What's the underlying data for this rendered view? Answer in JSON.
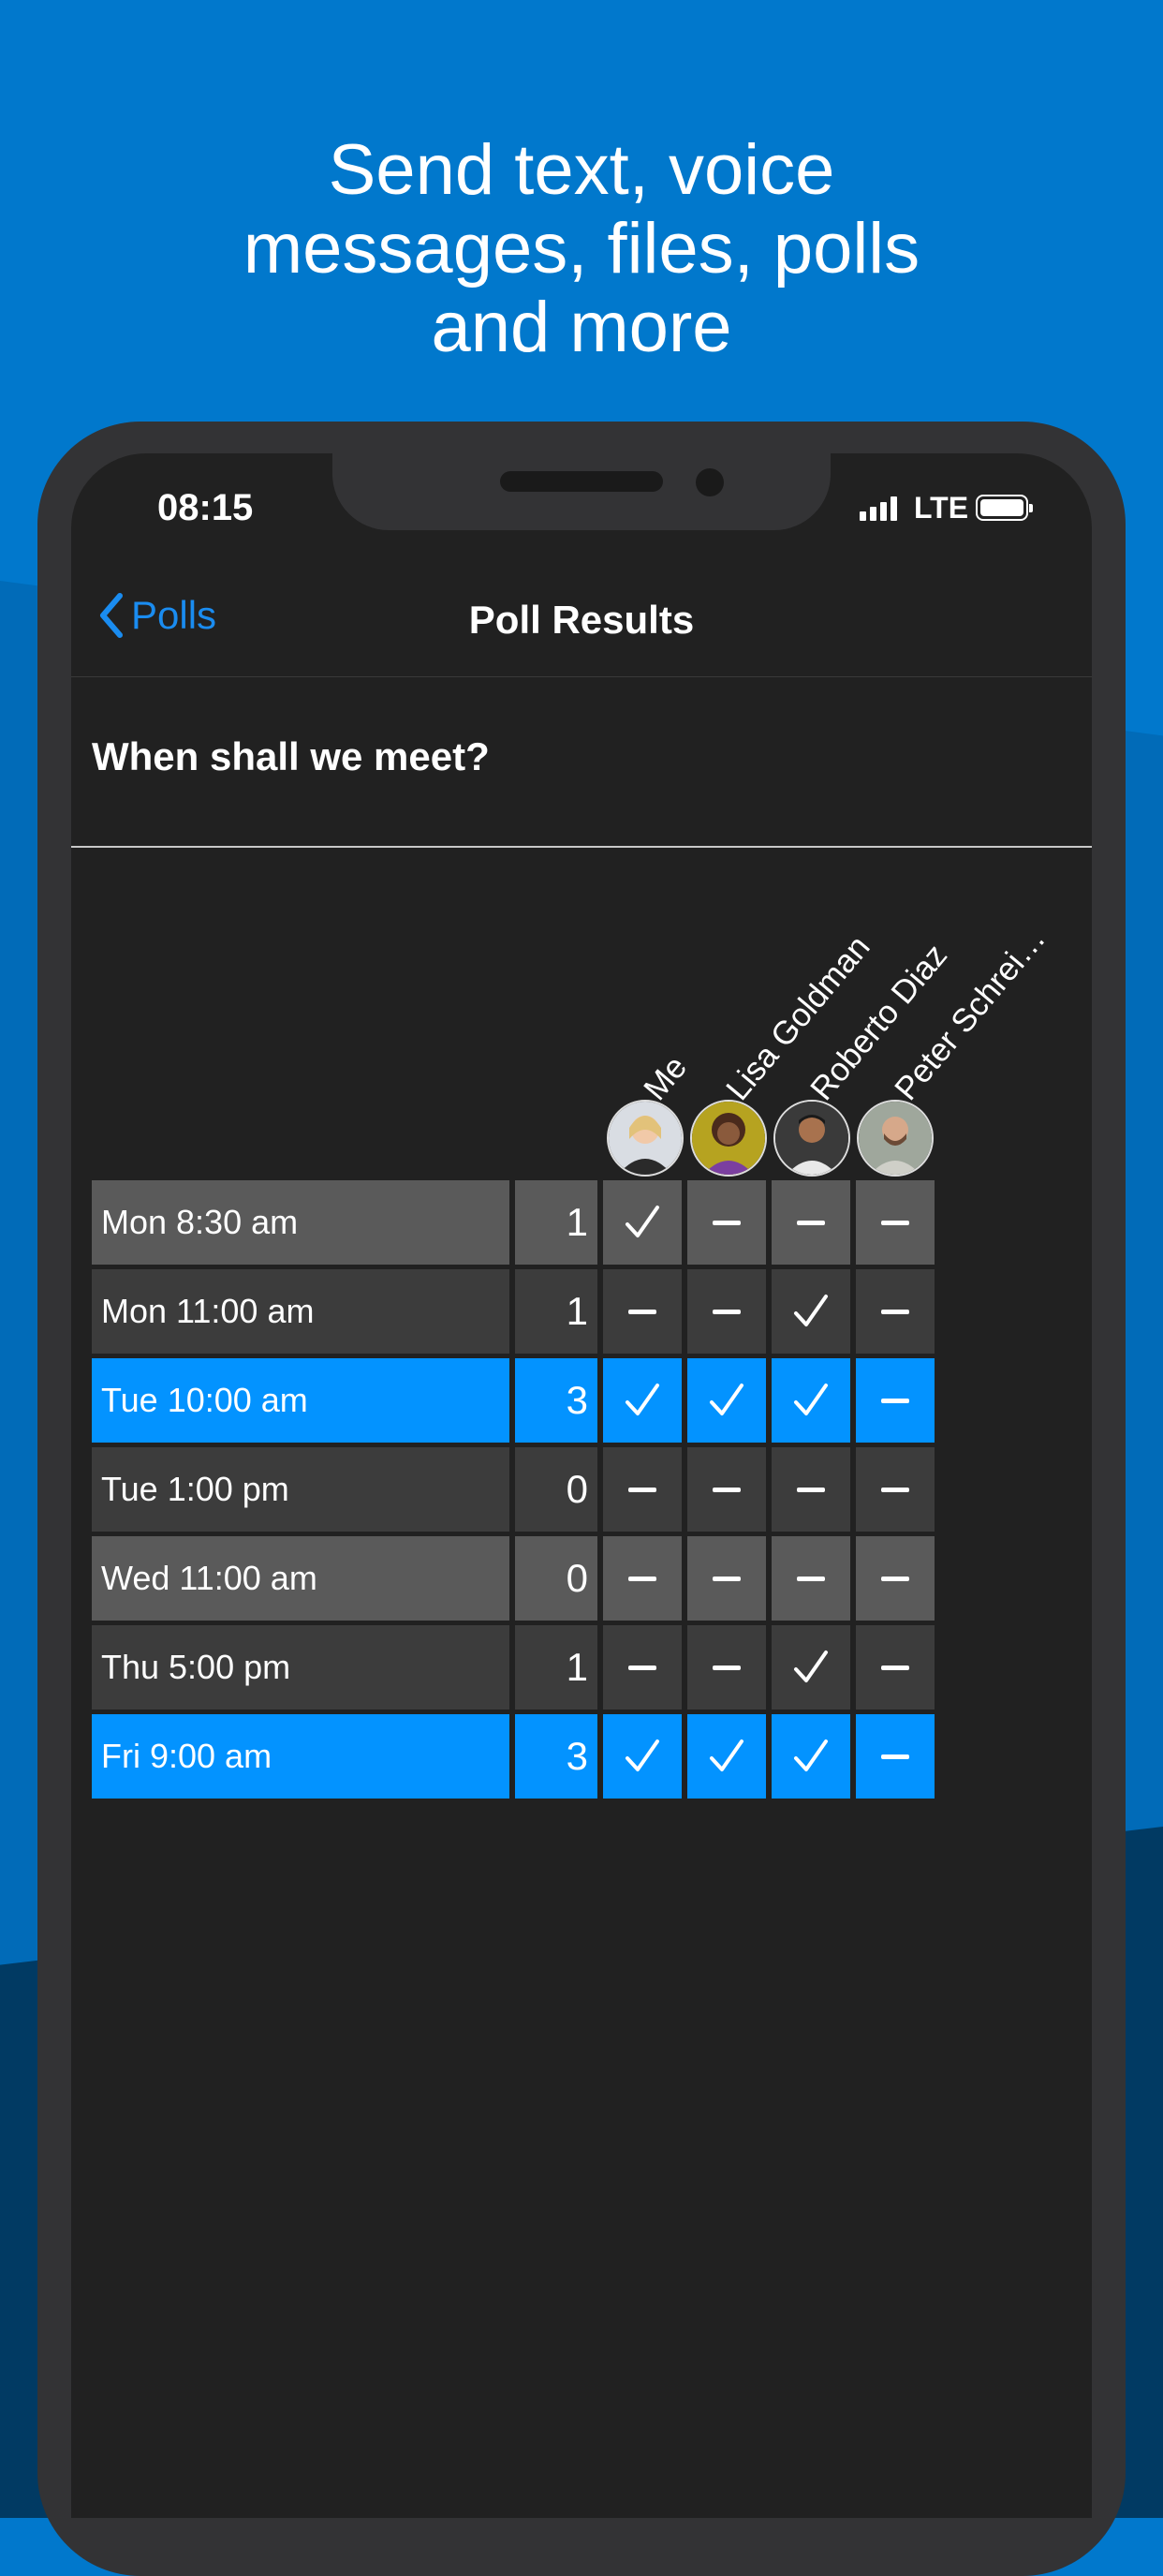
{
  "headline": {
    "line1": "Send text, voice",
    "line2": "messages, files, polls",
    "line3": "and more"
  },
  "status_bar": {
    "time": "08:15",
    "network": "LTE",
    "icons": [
      "cellular-signal-icon",
      "battery-icon"
    ]
  },
  "nav": {
    "back_label": "Polls",
    "back_icon": "chevron-left-icon",
    "title": "Poll Results"
  },
  "poll": {
    "question": "When shall we meet?",
    "participants": [
      {
        "name": "Me",
        "avatar": "avatar-me"
      },
      {
        "name": "Lisa Goldman",
        "avatar": "avatar-lisa"
      },
      {
        "name": "Roberto Diaz",
        "avatar": "avatar-roberto"
      },
      {
        "name": "Peter Schrei…",
        "avatar": "avatar-peter"
      }
    ],
    "options": [
      {
        "label": "Mon 8:30 am",
        "count": "1",
        "votes": [
          "yes",
          "no",
          "no",
          "no"
        ],
        "style": "grey-light"
      },
      {
        "label": "Mon 11:00 am",
        "count": "1",
        "votes": [
          "no",
          "no",
          "yes",
          "no"
        ],
        "style": "grey-dark"
      },
      {
        "label": "Tue 10:00 am",
        "count": "3",
        "votes": [
          "yes",
          "yes",
          "yes",
          "no"
        ],
        "style": "highlight"
      },
      {
        "label": "Tue 1:00 pm",
        "count": "0",
        "votes": [
          "no",
          "no",
          "no",
          "no"
        ],
        "style": "grey-dark"
      },
      {
        "label": "Wed 11:00 am",
        "count": "0",
        "votes": [
          "no",
          "no",
          "no",
          "no"
        ],
        "style": "grey-light"
      },
      {
        "label": "Thu 5:00 pm",
        "count": "1",
        "votes": [
          "no",
          "no",
          "yes",
          "no"
        ],
        "style": "grey-dark"
      },
      {
        "label": "Fri 9:00 am",
        "count": "3",
        "votes": [
          "yes",
          "yes",
          "yes",
          "no"
        ],
        "style": "highlight"
      }
    ]
  },
  "colors": {
    "background": "#0178cc",
    "highlight": "#0393ff",
    "grey_light": "#5a5a5a",
    "grey_dark": "#3c3c3c",
    "accent": "#1a8cf0"
  }
}
